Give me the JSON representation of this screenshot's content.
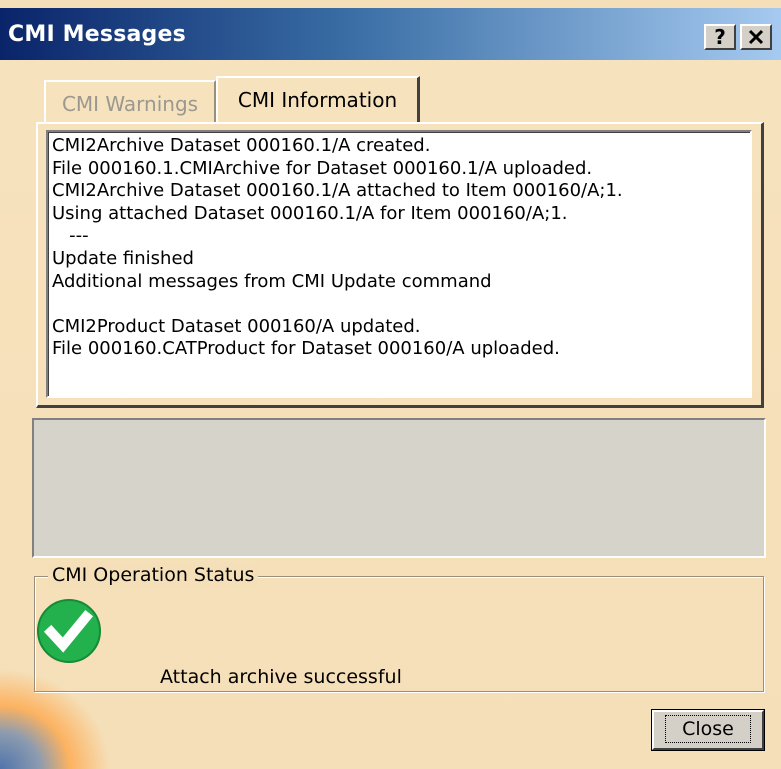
{
  "window": {
    "title": "CMI Messages",
    "help_label": "?",
    "colors": {
      "titlebar_start": "#0a246a",
      "titlebar_end": "#a6caf0",
      "background": "#f5dfb8",
      "success_green": "#22b14c"
    }
  },
  "tabs": [
    {
      "label": "CMI Warnings",
      "active": false
    },
    {
      "label": "CMI Information",
      "active": true
    }
  ],
  "messages": [
    "CMI2Archive Dataset 000160.1/A created.",
    "File 000160.1.CMIArchive for Dataset 000160.1/A uploaded.",
    "CMI2Archive Dataset 000160.1/A attached to Item 000160/A;1.",
    "Using attached Dataset 000160.1/A for Item 000160/A;1.",
    "   ---",
    "Update finished",
    "Additional messages from CMI Update command",
    "",
    "CMI2Product Dataset 000160/A updated.",
    "File 000160.CATProduct for Dataset 000160/A uploaded."
  ],
  "status": {
    "group_label": "CMI Operation Status",
    "icon": "check-circle-icon",
    "text": "Attach archive successful"
  },
  "buttons": {
    "close_label": "Close"
  }
}
